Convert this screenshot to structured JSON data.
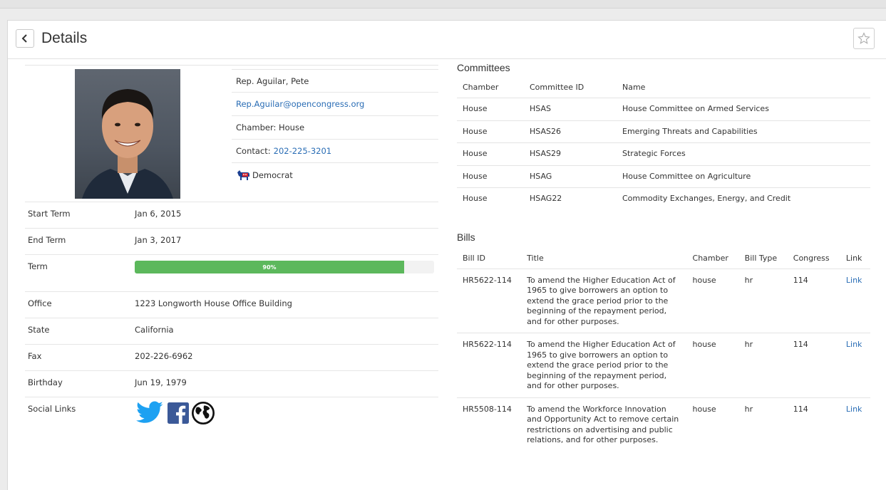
{
  "header": {
    "title": "Details"
  },
  "member": {
    "name": "Rep. Aguilar, Pete",
    "email": "Rep.Aguilar@opencongress.org",
    "chamber": "Chamber: House",
    "contact_label": "Contact:",
    "contact_phone": "202-225-3201",
    "party": "Democrat"
  },
  "info": {
    "start_term_label": "Start Term",
    "start_term": "Jan 6, 2015",
    "end_term_label": "End Term",
    "end_term": "Jan 3, 2017",
    "term_label": "Term",
    "term_progress": 90,
    "term_progress_text": "90%",
    "office_label": "Office",
    "office": "1223 Longworth House Office Building",
    "state_label": "State",
    "state": "California",
    "fax_label": "Fax",
    "fax": "202-226-6962",
    "birthday_label": "Birthday",
    "birthday": "Jun 19, 1979",
    "social_label": "Social Links"
  },
  "committees": {
    "title": "Committees",
    "headers": [
      "Chamber",
      "Committee ID",
      "Name"
    ],
    "rows": [
      [
        "House",
        "HSAS",
        "House Committee on Armed Services"
      ],
      [
        "House",
        "HSAS26",
        "Emerging Threats and Capabilities"
      ],
      [
        "House",
        "HSAS29",
        "Strategic Forces"
      ],
      [
        "House",
        "HSAG",
        "House Committee on Agriculture"
      ],
      [
        "House",
        "HSAG22",
        "Commodity Exchanges, Energy, and Credit"
      ]
    ]
  },
  "bills": {
    "title": "Bills",
    "headers": [
      "Bill ID",
      "Title",
      "Chamber",
      "Bill Type",
      "Congress",
      "Link"
    ],
    "rows": [
      [
        "HR5622-114",
        "To amend the Higher Education Act of 1965 to give borrowers an option to extend the grace period prior to the beginning of the repayment period, and for other purposes.",
        "house",
        "hr",
        "114",
        "Link"
      ],
      [
        "HR5622-114",
        "To amend the Higher Education Act of 1965 to give borrowers an option to extend the grace period prior to the beginning of the repayment period, and for other purposes.",
        "house",
        "hr",
        "114",
        "Link"
      ],
      [
        "HR5508-114",
        "To amend the Workforce Innovation and Opportunity Act to remove certain restrictions on advertising and public relations, and for other purposes.",
        "house",
        "hr",
        "114",
        "Link"
      ]
    ]
  },
  "colors": {
    "link": "#2a6db5",
    "progress": "#5cb85c",
    "twitter": "#1da1f2",
    "facebook": "#3b5998"
  }
}
